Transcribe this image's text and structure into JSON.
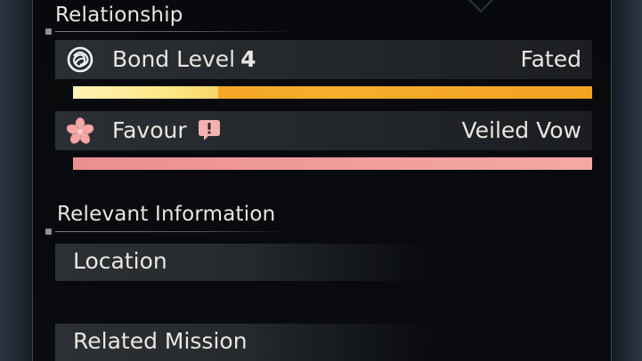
{
  "relationship": {
    "title": "Relationship",
    "bond": {
      "label": "Bond Level",
      "level": "4",
      "status": "Fated",
      "progress": 0.28,
      "icon": "knot-emblem-icon"
    },
    "favour": {
      "label": "Favour",
      "status": "Veiled Vow",
      "progress": 1.0,
      "icon": "sakura-flower-icon",
      "badge_icon": "exclamation-bubble-icon"
    }
  },
  "relevant_information": {
    "title": "Relevant Information",
    "items": [
      {
        "label": "Location"
      },
      {
        "label": "Related Mission"
      }
    ]
  },
  "colors": {
    "bond_bar": "#f5a623",
    "bond_fill": "#ffe88a",
    "favour_bar": "#f0a09c",
    "panel": "#08090c"
  }
}
